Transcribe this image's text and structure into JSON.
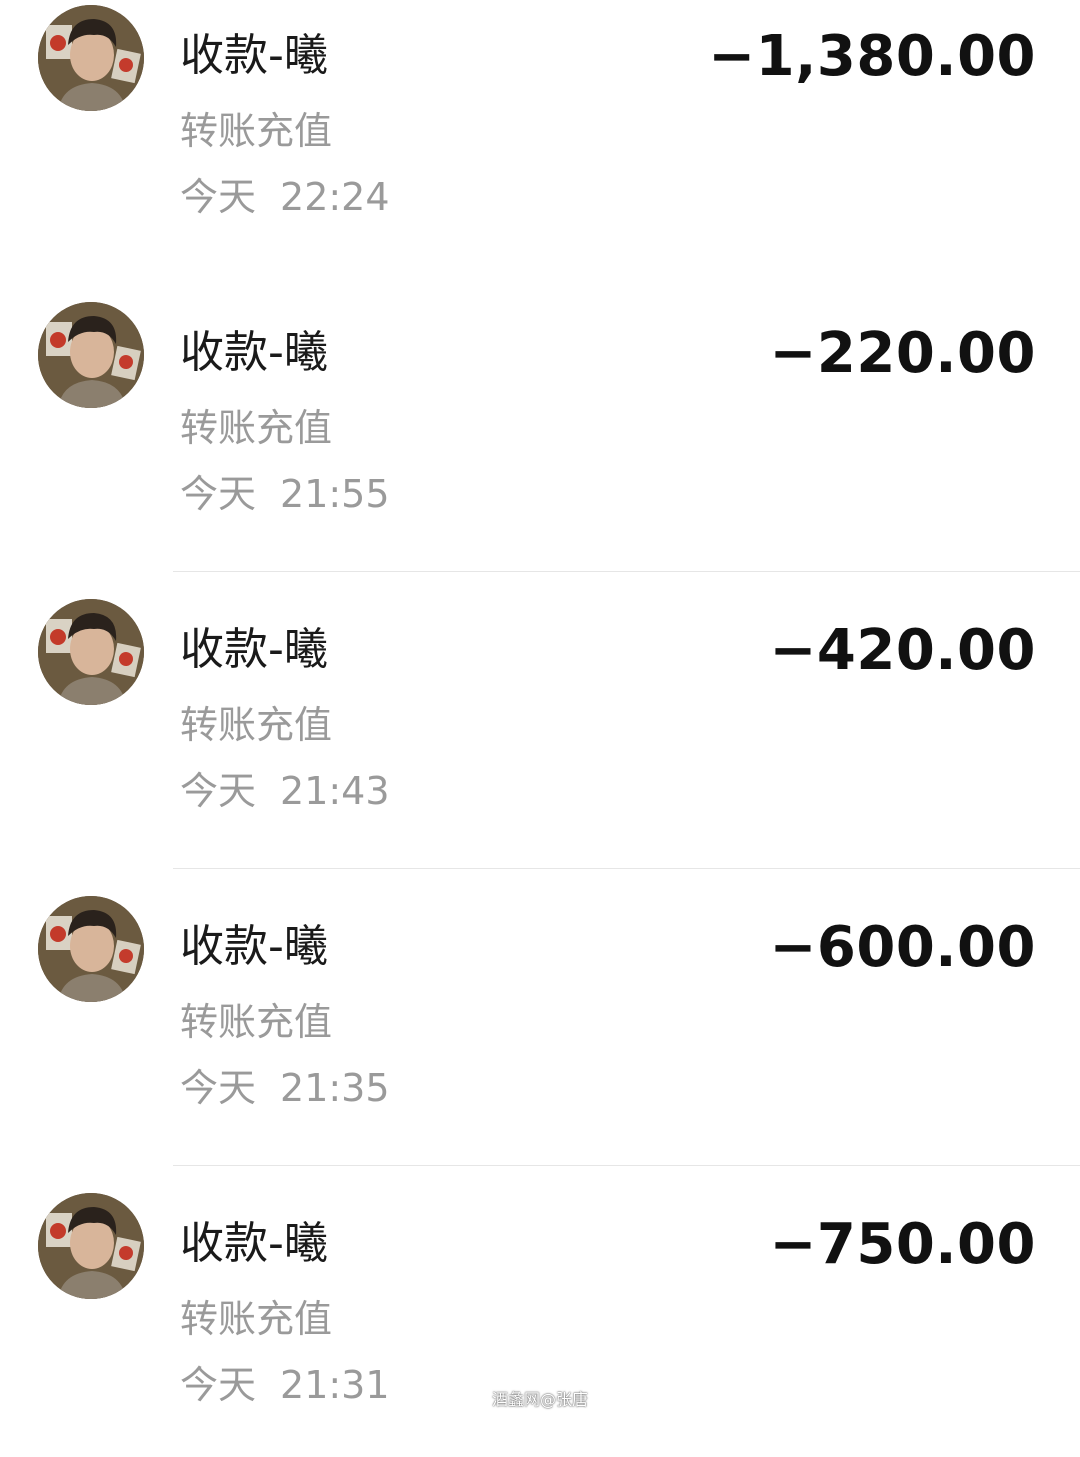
{
  "transactions": [
    {
      "title": "收款-曦",
      "subtitle": "转账充值",
      "day": "今天",
      "time": "22:24",
      "amount": "−1,380.00"
    },
    {
      "title": "收款-曦",
      "subtitle": "转账充值",
      "day": "今天",
      "time": "21:55",
      "amount": "−220.00"
    },
    {
      "title": "收款-曦",
      "subtitle": "转账充值",
      "day": "今天",
      "time": "21:43",
      "amount": "−420.00"
    },
    {
      "title": "收款-曦",
      "subtitle": "转账充值",
      "day": "今天",
      "time": "21:35",
      "amount": "−600.00"
    },
    {
      "title": "收款-曦",
      "subtitle": "转账充值",
      "day": "今天",
      "time": "21:31",
      "amount": "−750.00"
    }
  ],
  "watermark": "酒蠡网@张唐"
}
